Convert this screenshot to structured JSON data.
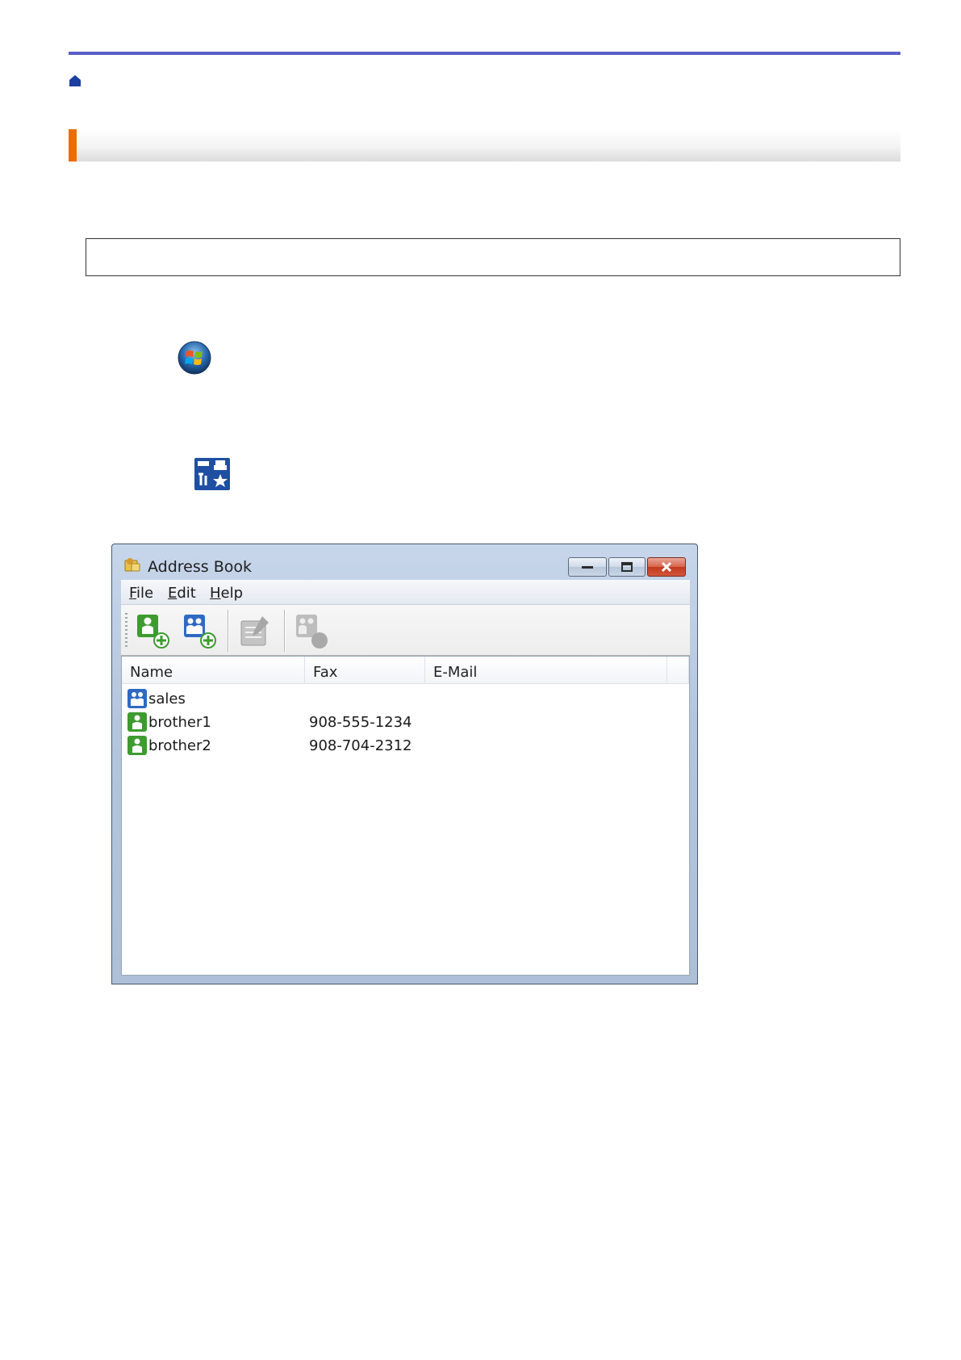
{
  "window": {
    "title": "Address Book",
    "menu": [
      {
        "label": "File"
      },
      {
        "label": "Edit"
      },
      {
        "label": "Help"
      }
    ],
    "columns": [
      "Name",
      "Fax",
      "E-Mail"
    ],
    "rows": [
      {
        "name": "sales",
        "fax": "",
        "email": "",
        "type": "group-icon"
      },
      {
        "name": "brother1",
        "fax": "908-555-1234",
        "email": "",
        "type": "person-icon"
      },
      {
        "name": "brother2",
        "fax": "908-704-2312",
        "email": "",
        "type": "person-icon"
      }
    ]
  },
  "colors": {
    "top_rule": "#5b5fc7",
    "section_accent": "#ef6c00",
    "contact_green": "#3d9b2f",
    "group_blue": "#2f69c3"
  }
}
